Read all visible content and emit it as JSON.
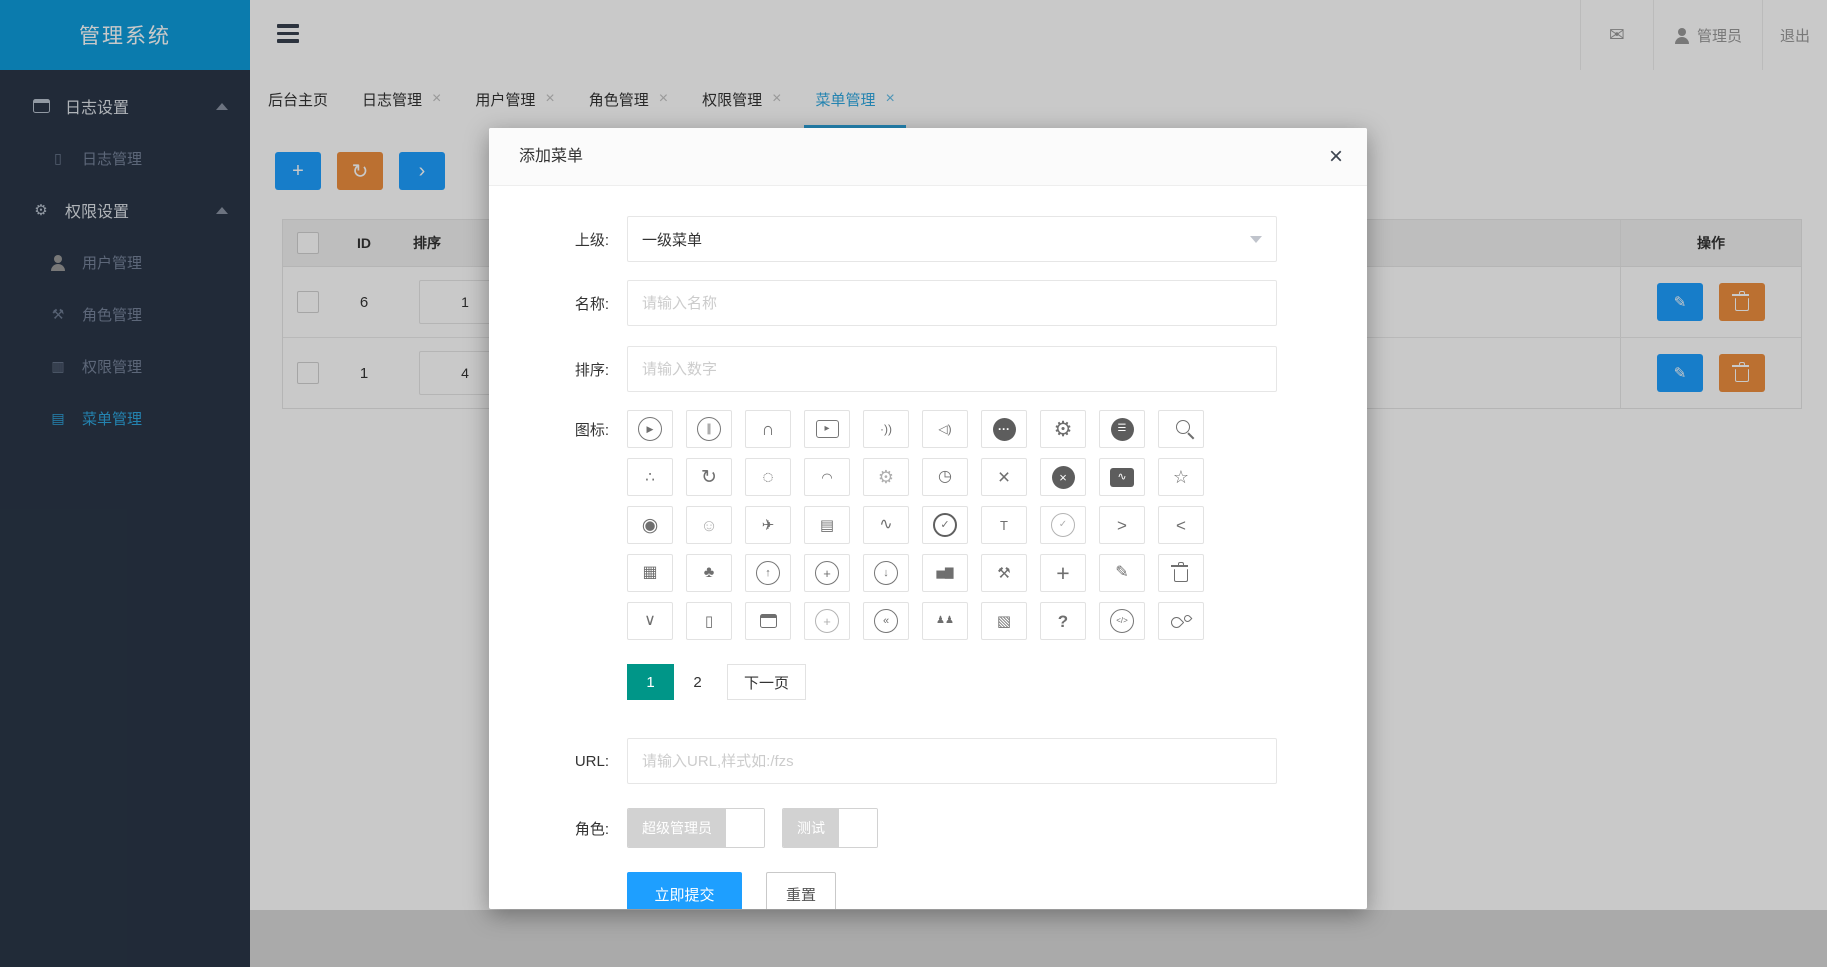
{
  "colors": {
    "accent": "#1E9FFF",
    "orange": "#ED8F3F",
    "teal": "#009688",
    "cyan": "#2EA7E0",
    "logo": "#0E9CDC",
    "sidebar": "#2A3647"
  },
  "app": {
    "title": "管理系统"
  },
  "topbar": {
    "mail_glyph": "✉",
    "user_label": "管理员",
    "logout_label": "退出"
  },
  "tabbar": {
    "close_glyph": "×"
  },
  "tabs": [
    {
      "id": "home",
      "label": "后台主页",
      "closable": false,
      "active": false
    },
    {
      "id": "log",
      "label": "日志管理",
      "closable": true,
      "active": false
    },
    {
      "id": "user",
      "label": "用户管理",
      "closable": true,
      "active": false
    },
    {
      "id": "role",
      "label": "角色管理",
      "closable": true,
      "active": false
    },
    {
      "id": "perm",
      "label": "权限管理",
      "closable": true,
      "active": false
    },
    {
      "id": "menu",
      "label": "菜单管理",
      "closable": true,
      "active": true
    }
  ],
  "sidebar": {
    "groups": [
      {
        "id": "log-settings",
        "label": "日志设置",
        "icon": "window-icon",
        "icon_css": "win",
        "expanded": true,
        "children": [
          {
            "id": "log-manage",
            "label": "日志管理",
            "icon": "file-icon",
            "glyph": "▯",
            "active": false
          }
        ]
      },
      {
        "id": "perm-settings",
        "label": "权限设置",
        "icon": "gear-icon",
        "glyph": "⚙",
        "expanded": true,
        "children": [
          {
            "id": "user-manage",
            "label": "用户管理",
            "icon": "user-icon",
            "icon_css": "user",
            "active": false
          },
          {
            "id": "role-manage",
            "label": "角色管理",
            "icon": "tools-icon",
            "glyph": "⚒",
            "active": false
          },
          {
            "id": "perm-manage",
            "label": "权限管理",
            "icon": "device-icon",
            "glyph": "▥",
            "active": false
          },
          {
            "id": "menu-manage",
            "label": "菜单管理",
            "icon": "list-icon",
            "glyph": "▤",
            "active": true
          }
        ]
      }
    ]
  },
  "toolbar": {
    "buttons": [
      {
        "id": "add",
        "glyph": "+",
        "style": "blue"
      },
      {
        "id": "refresh",
        "glyph": "↻",
        "style": "orange"
      },
      {
        "id": "expand",
        "glyph": "›",
        "style": "blue"
      }
    ]
  },
  "table": {
    "columns": {
      "id": "ID",
      "sort": "排序",
      "ops": "操作"
    },
    "edit_glyph": "✎",
    "rows": [
      {
        "id": "6",
        "sort": "1"
      },
      {
        "id": "1",
        "sort": "4"
      }
    ]
  },
  "modal": {
    "title": "添加菜单",
    "close_glyph": "×",
    "fields": {
      "parent": {
        "label": "上级:",
        "value": "一级菜单"
      },
      "name": {
        "label": "名称:",
        "placeholder": "请输入名称"
      },
      "sort": {
        "label": "排序:",
        "placeholder": "请输入数字"
      },
      "icon": {
        "label": "图标:"
      },
      "url": {
        "label": "URL:",
        "placeholder": "请输入URL,样式如:/fzs"
      },
      "roles": {
        "label": "角色:",
        "options": [
          "超级管理员",
          "测试"
        ]
      }
    },
    "icon_grid": [
      {
        "name": "play-circle",
        "glyph": "▶",
        "wrap": "circ",
        "size": 9
      },
      {
        "name": "pause-circle",
        "glyph": "∥",
        "wrap": "circ",
        "size": 11
      },
      {
        "name": "headset",
        "glyph": "∩",
        "size": 18
      },
      {
        "name": "video-play",
        "glyph": "▸",
        "wrap": "sqr",
        "size": 10
      },
      {
        "name": "signal",
        "glyph": "·))",
        "size": 12
      },
      {
        "name": "speaker",
        "glyph": "◁)",
        "size": 12
      },
      {
        "name": "comment-dots",
        "glyph": "···",
        "wrap": "fillcirc",
        "size": 12,
        "bold": true
      },
      {
        "name": "gear-filled",
        "glyph": "⚙",
        "size": 21
      },
      {
        "name": "menu-circle",
        "glyph": "☰",
        "wrap": "fillcirc",
        "size": 10
      },
      {
        "name": "search",
        "css": "mag"
      },
      {
        "name": "share",
        "glyph": "∴",
        "size": 15
      },
      {
        "name": "refresh",
        "glyph": "↻",
        "size": 19
      },
      {
        "name": "loading-dots",
        "glyph": "◌",
        "size": 19
      },
      {
        "name": "loading-arc",
        "glyph": "◠",
        "size": 13
      },
      {
        "name": "gear-outline",
        "glyph": "⚙",
        "size": 18,
        "light": true
      },
      {
        "name": "gauge",
        "glyph": "◷",
        "size": 16
      },
      {
        "name": "close",
        "glyph": "×",
        "size": 21
      },
      {
        "name": "close-circle",
        "glyph": "×",
        "wrap": "fillcirc",
        "size": 13
      },
      {
        "name": "chart-board",
        "glyph": "∿",
        "wrap": "fillsqr",
        "size": 11
      },
      {
        "name": "star",
        "glyph": "☆",
        "size": 18
      },
      {
        "name": "record",
        "glyph": "◉",
        "size": 19
      },
      {
        "name": "smiley",
        "glyph": "☺",
        "size": 17,
        "light": true
      },
      {
        "name": "send",
        "glyph": "✈",
        "size": 15
      },
      {
        "name": "document",
        "glyph": "▤",
        "size": 15
      },
      {
        "name": "pulse",
        "glyph": "∿",
        "size": 16
      },
      {
        "name": "check-circle-bold",
        "glyph": "✓",
        "wrap": "circ2",
        "size": 11
      },
      {
        "name": "tshirt",
        "glyph": "T",
        "size": 13
      },
      {
        "name": "check-circle",
        "glyph": "✓",
        "wrap": "circ",
        "size": 10,
        "light": true
      },
      {
        "name": "chevron-right",
        "glyph": ">",
        "size": 17
      },
      {
        "name": "chevron-left",
        "glyph": "<",
        "size": 17
      },
      {
        "name": "table",
        "glyph": "▦",
        "size": 16
      },
      {
        "name": "tree",
        "glyph": "♣",
        "size": 16
      },
      {
        "name": "arrow-up-circle",
        "glyph": "↑",
        "wrap": "circ",
        "size": 11
      },
      {
        "name": "plus-circle",
        "glyph": "+",
        "wrap": "circ",
        "size": 13
      },
      {
        "name": "arrow-down-circle",
        "glyph": "↓",
        "wrap": "circ",
        "size": 11
      },
      {
        "name": "bar-chart",
        "glyph": "▅▇",
        "size": 11
      },
      {
        "name": "tools",
        "glyph": "⚒",
        "size": 15
      },
      {
        "name": "plus",
        "glyph": "+",
        "size": 23
      },
      {
        "name": "pencil",
        "glyph": "✎",
        "size": 16
      },
      {
        "name": "trash",
        "css": "trash"
      },
      {
        "name": "chevron-down",
        "glyph": "∨",
        "size": 16
      },
      {
        "name": "file",
        "glyph": "▯",
        "size": 15
      },
      {
        "name": "window",
        "css": "win"
      },
      {
        "name": "plus-circle-thin",
        "glyph": "+",
        "wrap": "circ",
        "size": 13,
        "light": true
      },
      {
        "name": "prev-circle",
        "glyph": "«",
        "wrap": "circ",
        "size": 11
      },
      {
        "name": "group",
        "glyph": "♟♟",
        "size": 10
      },
      {
        "name": "picture",
        "glyph": "▧",
        "size": 15
      },
      {
        "name": "question",
        "glyph": "?",
        "size": 17,
        "bold": true
      },
      {
        "name": "code-circle",
        "glyph": "</>",
        "wrap": "circ",
        "size": 8
      },
      {
        "name": "water-drops",
        "css": "drops"
      }
    ],
    "pagination": [
      {
        "id": "1",
        "label": "1",
        "active": true,
        "bordered": false
      },
      {
        "id": "2",
        "label": "2",
        "active": false,
        "bordered": false
      },
      {
        "id": "next",
        "label": "下一页",
        "active": false,
        "bordered": true
      }
    ],
    "actions": {
      "submit_label": "立即提交",
      "reset_label": "重置"
    }
  }
}
